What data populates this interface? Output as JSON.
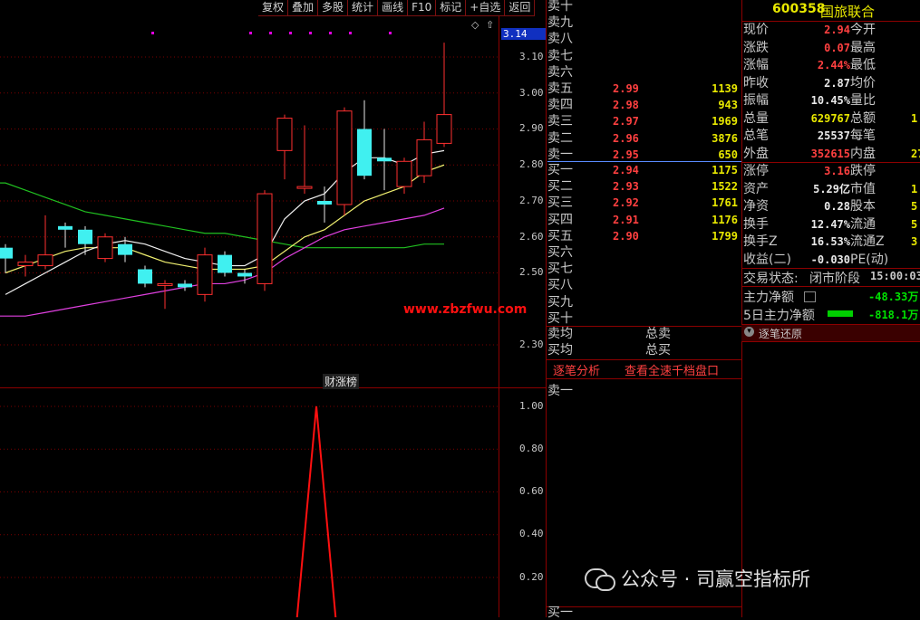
{
  "toolbar": [
    "复权",
    "叠加",
    "多股",
    "统计",
    "画线",
    "F10",
    "标记",
    "+自选",
    "返回"
  ],
  "stock": {
    "code": "600358",
    "name": "国旅联合"
  },
  "price_axis": [
    "3.14",
    "3.10",
    "3.00",
    "2.90",
    "2.80",
    "2.70",
    "2.60",
    "2.50",
    "2.30"
  ],
  "indicator_axis": [
    "1.00",
    "0.80",
    "0.60",
    "0.40",
    "0.20"
  ],
  "watermark": "www.zbzfwu.com",
  "indicator_title": "财涨榜",
  "asks": [
    {
      "label": "卖十",
      "price": "",
      "vol": ""
    },
    {
      "label": "卖九",
      "price": "",
      "vol": ""
    },
    {
      "label": "卖八",
      "price": "",
      "vol": ""
    },
    {
      "label": "卖七",
      "price": "",
      "vol": ""
    },
    {
      "label": "卖六",
      "price": "",
      "vol": ""
    },
    {
      "label": "卖五",
      "price": "2.99",
      "vol": "1139"
    },
    {
      "label": "卖四",
      "price": "2.98",
      "vol": "943"
    },
    {
      "label": "卖三",
      "price": "2.97",
      "vol": "1969"
    },
    {
      "label": "卖二",
      "price": "2.96",
      "vol": "3876"
    },
    {
      "label": "卖一",
      "price": "2.95",
      "vol": "650"
    }
  ],
  "bids": [
    {
      "label": "买一",
      "price": "2.94",
      "vol": "1175"
    },
    {
      "label": "买二",
      "price": "2.93",
      "vol": "1522"
    },
    {
      "label": "买三",
      "price": "2.92",
      "vol": "1761"
    },
    {
      "label": "买四",
      "price": "2.91",
      "vol": "1176"
    },
    {
      "label": "买五",
      "price": "2.90",
      "vol": "1799"
    },
    {
      "label": "买六",
      "price": "",
      "vol": ""
    },
    {
      "label": "买七",
      "price": "",
      "vol": ""
    },
    {
      "label": "买八",
      "price": "",
      "vol": ""
    },
    {
      "label": "买九",
      "price": "",
      "vol": ""
    },
    {
      "label": "买十",
      "price": "",
      "vol": ""
    }
  ],
  "avg": {
    "sell_avg": "卖均",
    "buy_avg": "买均",
    "total_sell": "总卖",
    "total_buy": "总买"
  },
  "tabs": {
    "tick": "逐笔分析",
    "full": "查看全速千档盘口"
  },
  "tick_first": "卖一",
  "tick_last": "买一",
  "quote": [
    {
      "l1": "现价",
      "v1": "2.94",
      "c1": "red",
      "l2": "今开",
      "v2": ""
    },
    {
      "l1": "涨跌",
      "v1": "0.07",
      "c1": "red",
      "l2": "最高",
      "v2": ""
    },
    {
      "l1": "涨幅",
      "v1": "2.44%",
      "c1": "red",
      "l2": "最低",
      "v2": ""
    },
    {
      "l1": "昨收",
      "v1": "2.87",
      "c1": "white",
      "l2": "均价",
      "v2": ""
    },
    {
      "l1": "振幅",
      "v1": "10.45%",
      "c1": "white",
      "l2": "量比",
      "v2": ""
    },
    {
      "l1": "总量",
      "v1": "629767",
      "c1": "yellow",
      "l2": "总额",
      "v2": "1"
    },
    {
      "l1": "总笔",
      "v1": "25537",
      "c1": "white",
      "l2": "每笔",
      "v2": ""
    },
    {
      "l1": "外盘",
      "v1": "352615",
      "c1": "red",
      "l2": "内盘",
      "v2": "27"
    }
  ],
  "quote2": [
    {
      "l1": "涨停",
      "v1": "3.16",
      "c1": "red",
      "l2": "跌停",
      "v2": ""
    },
    {
      "l1": "资产",
      "v1": "5.29亿",
      "c1": "white",
      "l2": "市值",
      "v2": "1"
    },
    {
      "l1": "净资",
      "v1": "0.28",
      "c1": "white",
      "l2": "股本",
      "v2": "5"
    },
    {
      "l1": "换手",
      "v1": "12.47%",
      "c1": "white",
      "l2": "流通",
      "v2": "5"
    },
    {
      "l1": "换手Z",
      "v1": "16.53%",
      "c1": "white",
      "l2": "流通Z",
      "v2": "3"
    },
    {
      "l1": "收益(二)",
      "v1": "-0.030",
      "c1": "white",
      "l2": "PE(动)",
      "v2": ""
    }
  ],
  "status": {
    "label": "交易状态:",
    "value": "闭市阶段",
    "time": "15:00:03"
  },
  "main_force": {
    "label": "主力净额",
    "value": "-48.33万"
  },
  "main_force5": {
    "label": "5日主力净额",
    "value": "-818.1万"
  },
  "tick_restore": "逐笔还原",
  "wechat": "公众号 · 司赢空指标所",
  "chart_data": {
    "type": "candlestick",
    "ylim": [
      2.24,
      3.2
    ],
    "candles": [
      {
        "o": 2.57,
        "c": 2.54,
        "h": 2.58,
        "l": 2.5
      },
      {
        "o": 2.52,
        "c": 2.53,
        "h": 2.55,
        "l": 2.49
      },
      {
        "o": 2.52,
        "c": 2.55,
        "h": 2.66,
        "l": 2.51
      },
      {
        "o": 2.63,
        "c": 2.62,
        "h": 2.64,
        "l": 2.57
      },
      {
        "o": 2.62,
        "c": 2.58,
        "h": 2.63,
        "l": 2.55
      },
      {
        "o": 2.54,
        "c": 2.6,
        "h": 2.61,
        "l": 2.53
      },
      {
        "o": 2.58,
        "c": 2.55,
        "h": 2.6,
        "l": 2.53
      },
      {
        "o": 2.51,
        "c": 2.47,
        "h": 2.52,
        "l": 2.46
      },
      {
        "o": 2.47,
        "c": 2.47,
        "h": 2.48,
        "l": 2.4
      },
      {
        "o": 2.47,
        "c": 2.46,
        "h": 2.48,
        "l": 2.45
      },
      {
        "o": 2.44,
        "c": 2.55,
        "h": 2.57,
        "l": 2.42
      },
      {
        "o": 2.55,
        "c": 2.5,
        "h": 2.56,
        "l": 2.49
      },
      {
        "o": 2.5,
        "c": 2.49,
        "h": 2.51,
        "l": 2.47
      },
      {
        "o": 2.47,
        "c": 2.72,
        "h": 2.73,
        "l": 2.45
      },
      {
        "o": 2.84,
        "c": 2.93,
        "h": 2.94,
        "l": 2.76
      },
      {
        "o": 2.74,
        "c": 2.74,
        "h": 2.91,
        "l": 2.72
      },
      {
        "o": 2.7,
        "c": 2.69,
        "h": 2.74,
        "l": 2.64
      },
      {
        "o": 2.69,
        "c": 2.95,
        "h": 2.96,
        "l": 2.66
      },
      {
        "o": 2.9,
        "c": 2.77,
        "h": 2.98,
        "l": 2.76
      },
      {
        "o": 2.82,
        "c": 2.81,
        "h": 2.9,
        "l": 2.73
      },
      {
        "o": 2.74,
        "c": 2.81,
        "h": 2.82,
        "l": 2.72
      },
      {
        "o": 2.77,
        "c": 2.87,
        "h": 2.92,
        "l": 2.75
      },
      {
        "o": 2.86,
        "c": 2.94,
        "h": 3.14,
        "l": 2.85
      }
    ],
    "ma_white": [
      2.44,
      2.47,
      2.5,
      2.53,
      2.56,
      2.58,
      2.59,
      2.58,
      2.56,
      2.54,
      2.53,
      2.52,
      2.52,
      2.55,
      2.65,
      2.7,
      2.72,
      2.78,
      2.82,
      2.82,
      2.8,
      2.83,
      2.84
    ],
    "ma_yellow": [
      2.5,
      2.52,
      2.54,
      2.56,
      2.57,
      2.57,
      2.57,
      2.55,
      2.53,
      2.52,
      2.51,
      2.51,
      2.51,
      2.52,
      2.56,
      2.6,
      2.62,
      2.66,
      2.7,
      2.72,
      2.74,
      2.78,
      2.8
    ],
    "ma_magenta": [
      2.38,
      2.38,
      2.39,
      2.4,
      2.41,
      2.42,
      2.43,
      2.44,
      2.45,
      2.46,
      2.47,
      2.47,
      2.48,
      2.5,
      2.54,
      2.57,
      2.6,
      2.62,
      2.63,
      2.64,
      2.65,
      2.66,
      2.68
    ],
    "ma_green": [
      2.75,
      2.73,
      2.71,
      2.69,
      2.67,
      2.66,
      2.65,
      2.64,
      2.63,
      2.62,
      2.61,
      2.61,
      2.6,
      2.59,
      2.58,
      2.57,
      2.57,
      2.57,
      2.57,
      2.57,
      2.57,
      2.58,
      2.58
    ],
    "indicator": {
      "ylim": [
        0,
        1.1
      ],
      "values": [
        0,
        0,
        0,
        0,
        0,
        0,
        0,
        0,
        0,
        0,
        0,
        0,
        0,
        0,
        0,
        1.0,
        0,
        0,
        0,
        0,
        0,
        0,
        0
      ]
    }
  }
}
